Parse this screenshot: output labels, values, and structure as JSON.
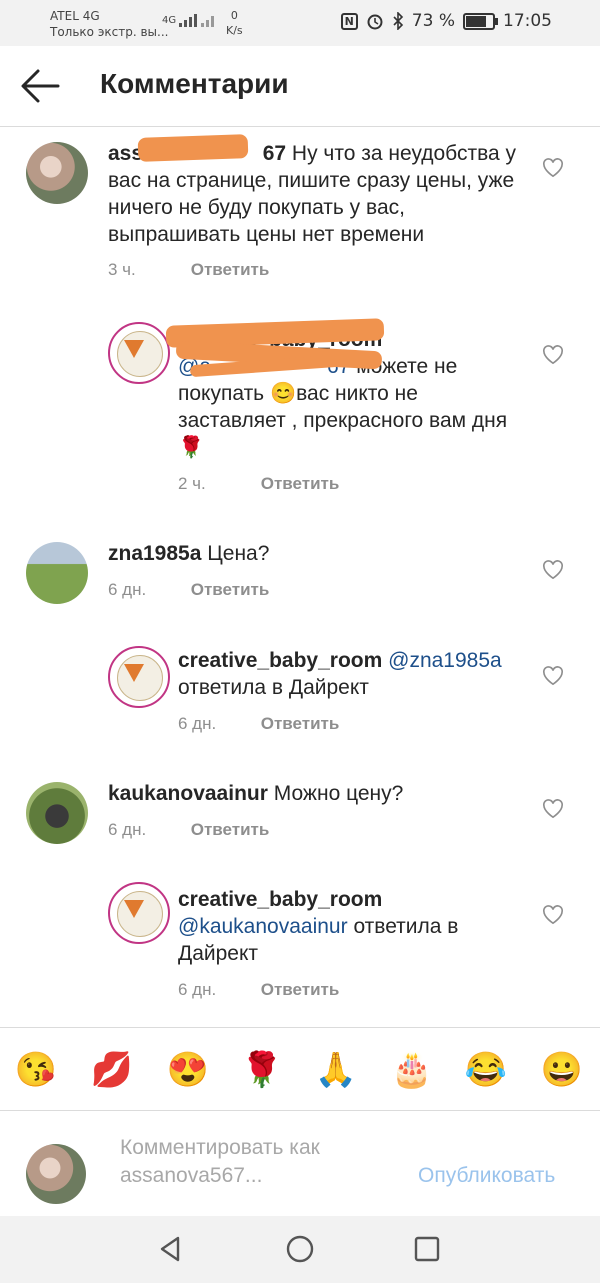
{
  "status_bar": {
    "carrier": "ATEL 4G",
    "subtitle": "Только экстр. вы...",
    "net": "4G",
    "speed_value": "0",
    "speed_unit": "K/s",
    "nfc": "N",
    "battery": "73 %",
    "battery_level": 0.73,
    "time": "17:05"
  },
  "header": {
    "title": "Комментарии"
  },
  "comments": [
    {
      "username": "assa",
      "username_tail": "67",
      "text": "Ну что за неудобства у вас на странице, пишите сразу цены, уже ничего не буду покупать у вас, выпрашивать цены нет времени",
      "time": "3 ч.",
      "reply": "Ответить"
    },
    {
      "username": "creative_baby_room",
      "mention": "@a",
      "mention_tail": "67",
      "text": " можете не покупать 😊вас никто не заставляет , прекрасного вам дня 🌹",
      "time": "2 ч.",
      "reply": "Ответить"
    },
    {
      "username": "zna1985a",
      "text": "Цена?",
      "time": "6 дн.",
      "reply": "Ответить"
    },
    {
      "username": "creative_baby_room",
      "mention": "@zna1985a",
      "text": "ответила в Дайрект",
      "time": "6 дн.",
      "reply": "Ответить"
    },
    {
      "username": "kaukanovaainur",
      "text": "Можно цену?",
      "time": "6 дн.",
      "reply": "Ответить"
    },
    {
      "username": "creative_baby_room",
      "mention": "@kaukanovaainur",
      "text": "ответила в Дайрект",
      "time": "6 дн.",
      "reply": "Ответить"
    }
  ],
  "emojis": [
    "😘",
    "💋",
    "😍",
    "🌹",
    "🙏",
    "🎂",
    "😂",
    "😀"
  ],
  "composer": {
    "placeholder_line1": "Комментировать как",
    "placeholder_line2": "assanova567...",
    "publish": "Опубликовать"
  },
  "colors": {
    "link": "#1d4f8a",
    "muted": "#8e8e8e",
    "publish_disabled": "#9ac3ec",
    "scribble": "#f0934e"
  },
  "icons": {
    "back": "arrow-left",
    "like": "heart-outline",
    "nav_back": "triangle-left",
    "nav_home": "circle",
    "nav_recent": "square"
  }
}
